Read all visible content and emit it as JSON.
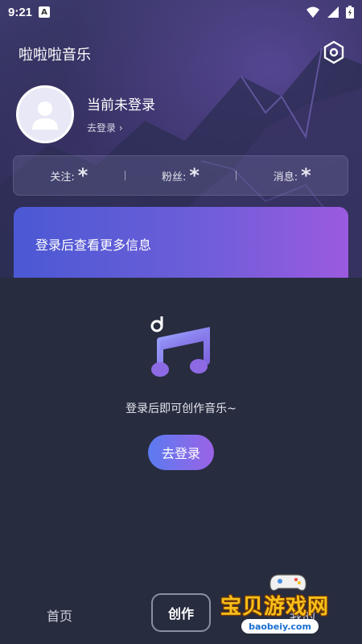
{
  "status_bar": {
    "time": "9:21",
    "notification_badge": "A"
  },
  "header": {
    "app_title": "啦啦啦音乐"
  },
  "profile": {
    "login_status": "当前未登录",
    "go_login_link": "去登录"
  },
  "stats": [
    {
      "label": "关注:",
      "value": "*"
    },
    {
      "label": "粉丝:",
      "value": "*"
    },
    {
      "label": "消息:",
      "value": "*"
    }
  ],
  "promo": {
    "text": "登录后查看更多信息"
  },
  "empty_state": {
    "text": "登录后即可创作音乐~",
    "button_label": "去登录"
  },
  "bottom_nav": {
    "home": "首页",
    "create": "创作",
    "mine": "我的"
  },
  "watermark": {
    "brand": "宝贝游戏网",
    "url": "baobeiy.com"
  },
  "colors": {
    "accent_start": "#4b58d4",
    "accent_end": "#9b5ae0",
    "background": "#272c3f"
  },
  "icons": {
    "settings": "hexagon-settings-icon",
    "music": "music-note-icon",
    "avatar": "user-avatar-icon"
  }
}
